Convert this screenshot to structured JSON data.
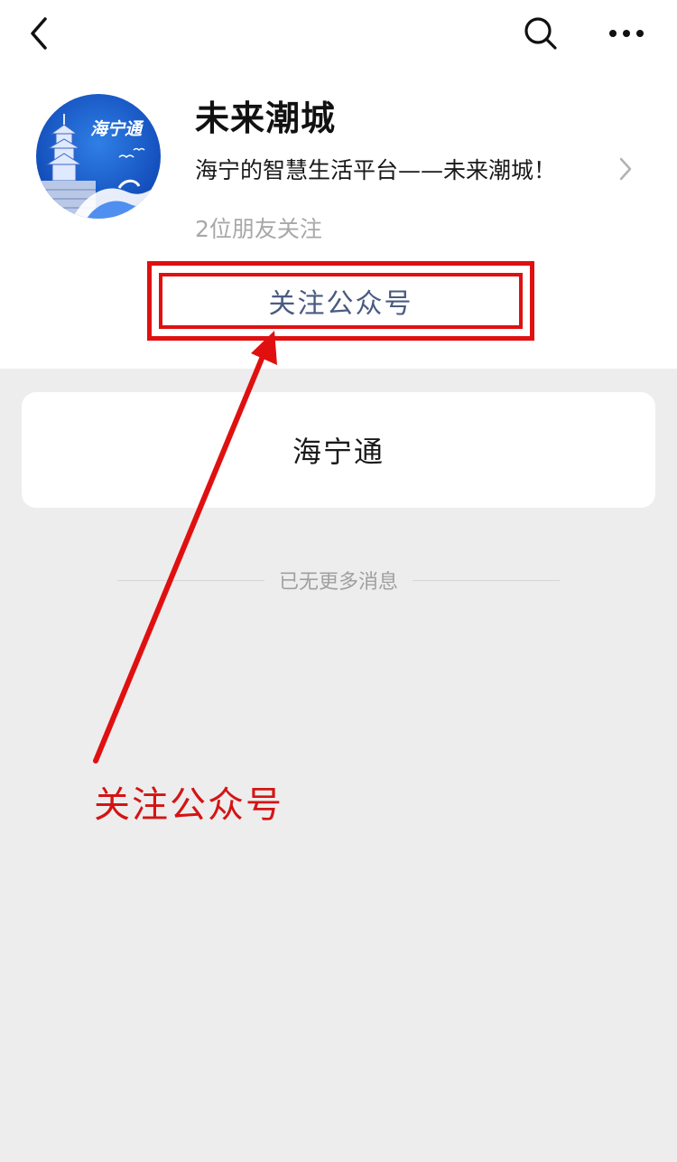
{
  "header": {
    "back_icon": "chevron-left-icon",
    "search_icon": "search-icon",
    "more_icon": "more-dots-icon"
  },
  "profile": {
    "avatar_text": "海宁通",
    "name": "未来潮城",
    "description": "海宁的智慧生活平台——未来潮城！",
    "friends_following": "2位朋友关注",
    "follow_button_label": "关注公众号"
  },
  "menu": {
    "items": [
      {
        "label": "海宁通"
      }
    ]
  },
  "feed": {
    "end_text": "已无更多消息"
  },
  "annotation": {
    "label": "关注公众号",
    "color": "#e01010"
  },
  "colors": {
    "background": "#ededed",
    "card": "#ffffff",
    "link_text": "#4a5b80",
    "annotation_red": "#e01010"
  }
}
